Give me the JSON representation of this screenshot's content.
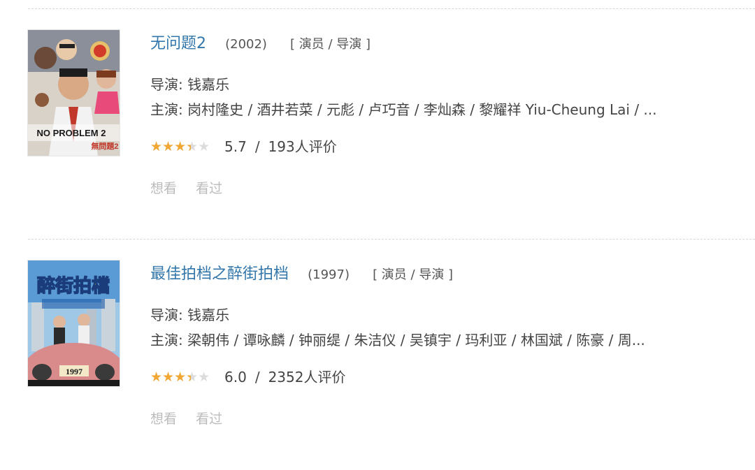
{
  "movies": [
    {
      "title": "无问题2",
      "year": "(2002)",
      "roles": "[ 演员 / 导演 ]",
      "director": "导演: 钱嘉乐",
      "cast": "主演: 岗村隆史 / 酒井若菜 / 元彪 / 卢巧音 / 李灿森 / 黎耀祥 Yiu-Cheung Lai / ...",
      "rating": 5.7,
      "rating_text": "5.7",
      "stars_fraction": 0.6,
      "separator": "/",
      "votes": "193人评价",
      "want_label": "想看",
      "seen_label": "看过",
      "poster": {
        "text_main": "NO PROBLEM 2",
        "text_sub": "無問題2"
      }
    },
    {
      "title": "最佳拍档之醉街拍档",
      "year": "(1997)",
      "roles": "[ 演员 / 导演 ]",
      "director": "导演: 钱嘉乐",
      "cast": "主演: 梁朝伟 / 谭咏麟 / 钟丽缇 / 朱洁仪 / 吴镇宇 / 玛利亚 / 林国斌 / 陈豪 / 周...",
      "rating": 6.0,
      "rating_text": "6.0",
      "stars_fraction": 0.6,
      "separator": "/",
      "votes": "2352人评价",
      "want_label": "想看",
      "seen_label": "看过",
      "poster": {
        "text_main": "醉街拍檔",
        "text_sub": "1997"
      }
    }
  ],
  "colors": {
    "title": "#3377aa",
    "star_on": "#f0a733",
    "star_off": "#dcdcdc",
    "action": "#bbbbbb"
  }
}
